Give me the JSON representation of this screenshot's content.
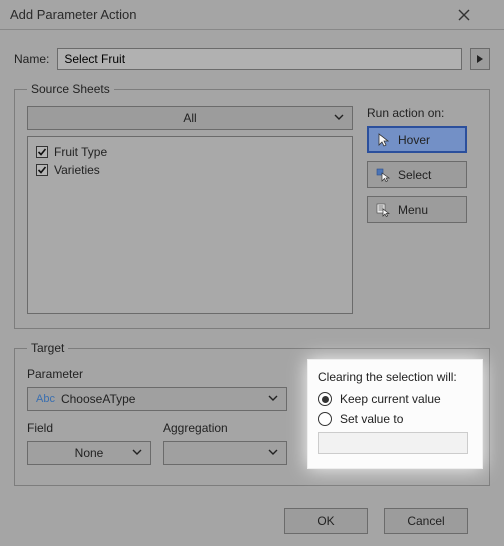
{
  "dialog": {
    "title": "Add Parameter Action"
  },
  "name": {
    "label": "Name:",
    "value": "Select Fruit"
  },
  "source": {
    "legend": "Source Sheets",
    "all_label": "All",
    "items": [
      {
        "label": "Fruit Type",
        "checked": true
      },
      {
        "label": "Varieties",
        "checked": true
      }
    ],
    "run_label": "Run action on:",
    "actions": {
      "hover": "Hover",
      "select": "Select",
      "menu": "Menu"
    }
  },
  "target": {
    "legend": "Target",
    "parameter_label": "Parameter",
    "parameter_prefix": "Abc",
    "parameter_value": "ChooseAType",
    "field_label": "Field",
    "aggregation_label": "Aggregation",
    "field_value": "None",
    "clearing_label": "Clearing the selection will:",
    "keep_label": "Keep current value",
    "set_label": "Set value to"
  },
  "footer": {
    "ok": "OK",
    "cancel": "Cancel"
  }
}
